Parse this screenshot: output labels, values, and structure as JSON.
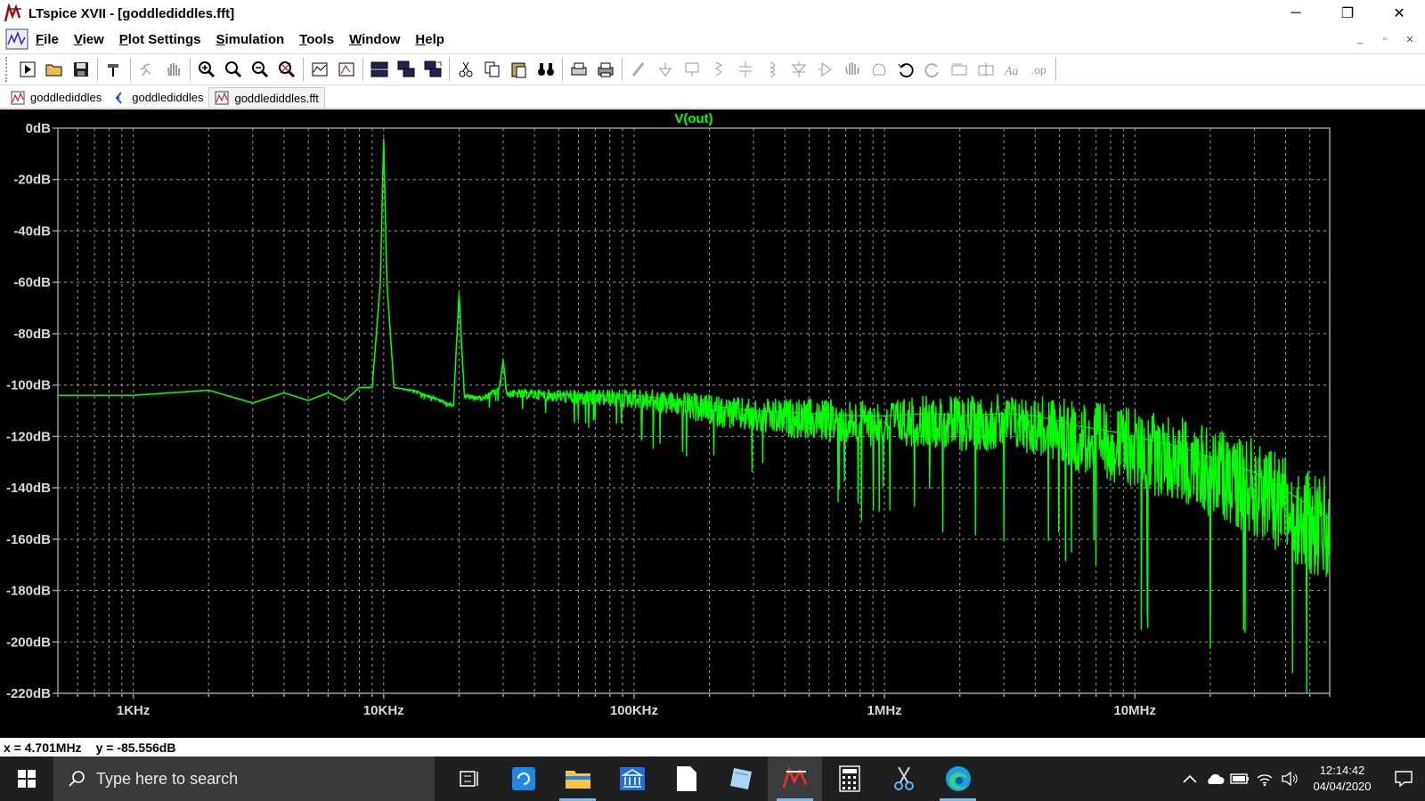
{
  "window": {
    "title": "LTspice XVII - [goddlediddles.fft]",
    "minimize": "─",
    "maximize": "❐",
    "close": "✕"
  },
  "menu": [
    "File",
    "View",
    "Plot Settings",
    "Simulation",
    "Tools",
    "Window",
    "Help"
  ],
  "mdi": {
    "minimize": "_",
    "restore": "▫",
    "close": "✕"
  },
  "tabs": [
    {
      "label": "goddlediddles",
      "icon": "waveform-icon",
      "active": false
    },
    {
      "label": "goddlediddles",
      "icon": "schematic-icon",
      "active": false
    },
    {
      "label": "goddlediddles.fft",
      "icon": "waveform-icon",
      "active": true
    }
  ],
  "colors": {
    "trace": "#00ff00",
    "background": "#000000",
    "grid": "#9a9a9a",
    "axis_text": "#d8d8d8"
  },
  "chart_data": {
    "type": "line",
    "title": "V(out)",
    "xscale": "log",
    "xlim": [
      500,
      60000000
    ],
    "ylim": [
      -220,
      0
    ],
    "xticks": [
      {
        "value": 1000,
        "label": "1KHz"
      },
      {
        "value": 10000,
        "label": "10KHz"
      },
      {
        "value": 100000,
        "label": "100KHz"
      },
      {
        "value": 1000000,
        "label": "1MHz"
      },
      {
        "value": 10000000,
        "label": "10MHz"
      }
    ],
    "yticks": [
      {
        "value": 0,
        "label": "0dB"
      },
      {
        "value": -20,
        "label": "-20dB"
      },
      {
        "value": -40,
        "label": "-40dB"
      },
      {
        "value": -60,
        "label": "-60dB"
      },
      {
        "value": -80,
        "label": "-80dB"
      },
      {
        "value": -100,
        "label": "-100dB"
      },
      {
        "value": -120,
        "label": "-120dB"
      },
      {
        "value": -140,
        "label": "-140dB"
      },
      {
        "value": -160,
        "label": "-160dB"
      },
      {
        "value": -180,
        "label": "-180dB"
      },
      {
        "value": -200,
        "label": "-200dB"
      },
      {
        "value": -220,
        "label": "-220dB"
      }
    ],
    "grid": true,
    "series": [
      {
        "x": [
          500,
          1000,
          2000,
          3000,
          4000,
          5000,
          6000,
          7000,
          8000,
          9000,
          9700,
          10000,
          10300,
          11000,
          13000,
          16000,
          19000,
          20000,
          21000,
          25000,
          29000,
          30000,
          31000,
          40000,
          60000,
          100000,
          150000,
          200000,
          300000,
          500000,
          800000,
          1000000,
          1500000,
          2000000,
          3000000,
          4000000,
          5000000,
          6000000,
          8000000,
          10000000,
          15000000,
          20000000,
          30000000,
          40000000,
          50000000,
          60000000
        ],
        "y": [
          -104,
          -104,
          -102,
          -107,
          -103,
          -106,
          -103,
          -106,
          -101,
          -101,
          -60,
          -4,
          -60,
          -101,
          -102,
          -105,
          -108,
          -64,
          -104,
          -105,
          -101,
          -90,
          -103,
          -103,
          -104,
          -104,
          -106,
          -108,
          -110,
          -111,
          -112,
          -112,
          -111,
          -112,
          -111,
          -112,
          -114,
          -116,
          -118,
          -120,
          -124,
          -128,
          -134,
          -141,
          -147,
          -152
        ],
        "spread": [
          0,
          0,
          0,
          0,
          0,
          0,
          0,
          0,
          0,
          0,
          0,
          0,
          0,
          0,
          1,
          1,
          2,
          2,
          2,
          2,
          3,
          3,
          3,
          4,
          6,
          8,
          10,
          12,
          14,
          16,
          18,
          18,
          20,
          22,
          22,
          24,
          26,
          28,
          30,
          32,
          34,
          36,
          38,
          40,
          42,
          44
        ]
      }
    ]
  },
  "status": {
    "cursor_x": "x = 4.701MHz",
    "cursor_y": "y = -85.556dB"
  },
  "taskbar": {
    "search_placeholder": "Type here to search",
    "apps": [
      "task-view",
      "app-store",
      "file-explorer",
      "bank",
      "document",
      "notes",
      "ltspice",
      "calculator",
      "snipping-tool",
      "edge"
    ],
    "time": "12:14:42",
    "date": "04/04/2020"
  }
}
